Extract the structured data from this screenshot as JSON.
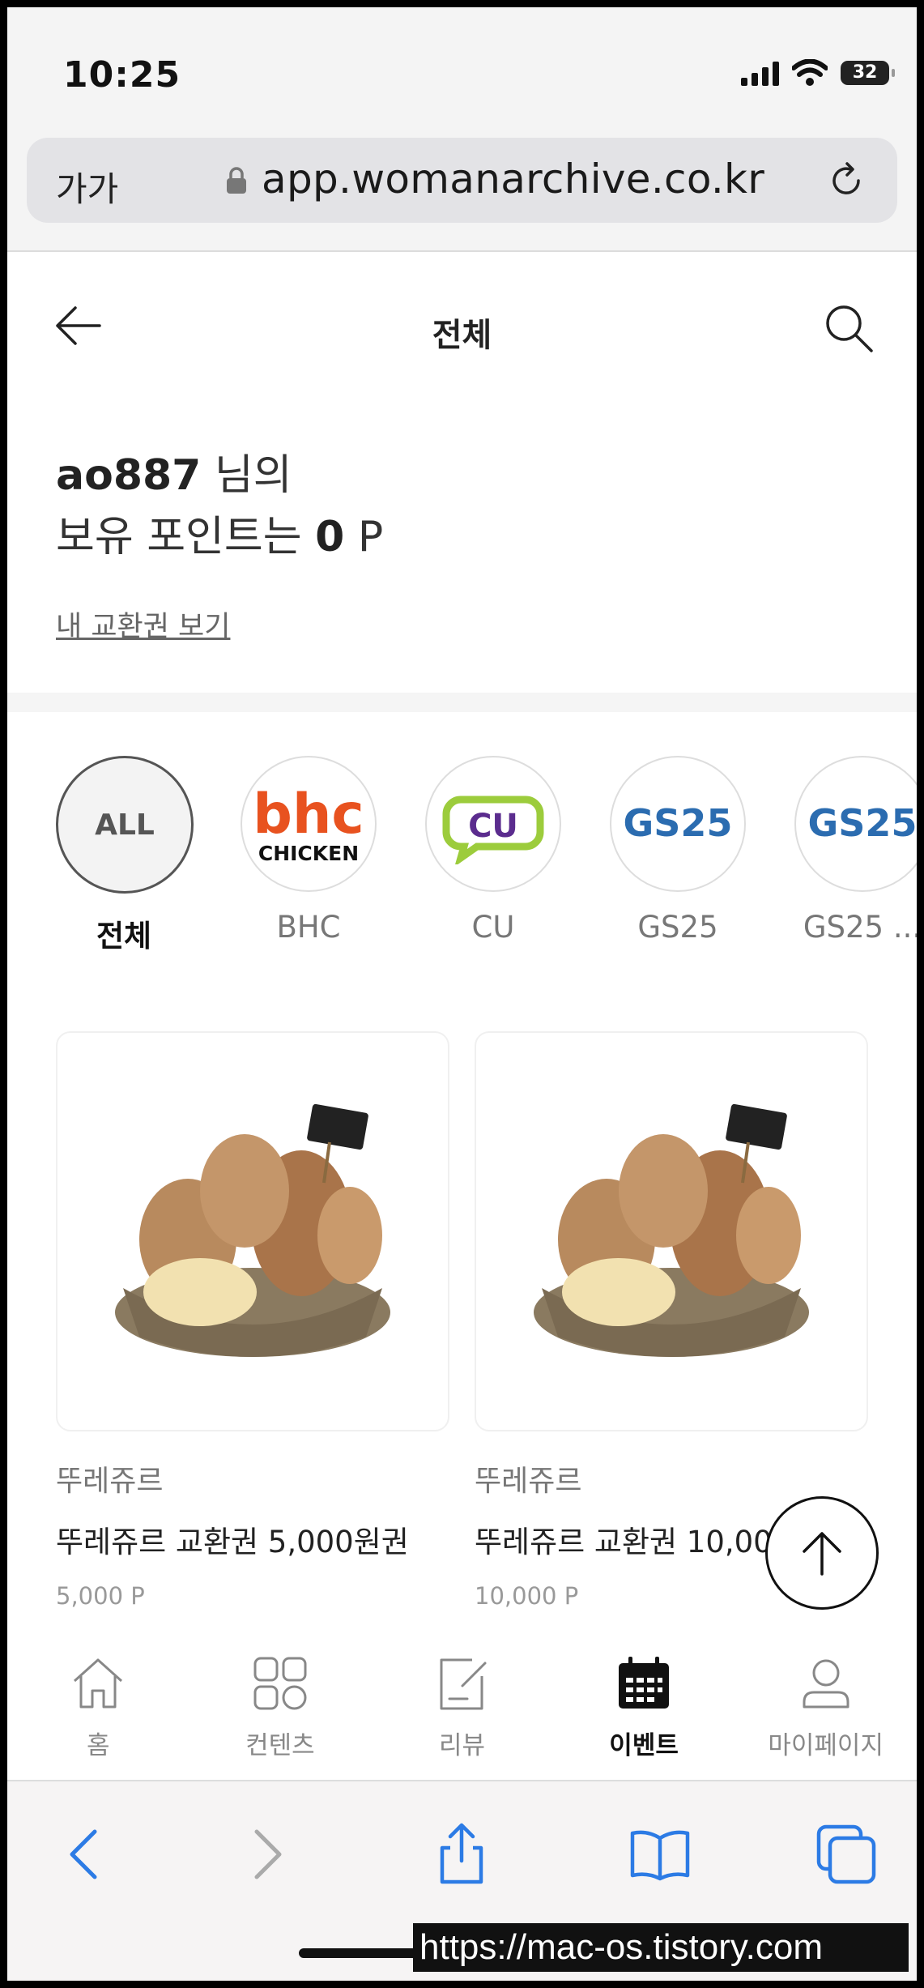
{
  "status_bar": {
    "time": "10:25",
    "battery": "32"
  },
  "browser": {
    "text_size": "가가",
    "url": "app.womanarchive.co.kr"
  },
  "header": {
    "title": "전체"
  },
  "points": {
    "username": "ao887",
    "suffix": "님의",
    "line2_prefix": "보유 포인트는",
    "amount": "0",
    "unit": "P",
    "voucher_link": "내 교환권 보기"
  },
  "brands": [
    {
      "label": "전체",
      "logo_text": "ALL"
    },
    {
      "label": "BHC",
      "logo_text_top": "bhc",
      "logo_text_bottom": "CHICKEN"
    },
    {
      "label": "CU",
      "logo_text": "CU"
    },
    {
      "label": "GS25",
      "logo_text": "GS25"
    },
    {
      "label": "GS25 ...",
      "logo_text": "GS25"
    }
  ],
  "products": [
    {
      "brand": "뚜레쥬르",
      "name": "뚜레쥬르 교환권 5,000원권",
      "price": "5,000 P"
    },
    {
      "brand": "뚜레쥬르",
      "name": "뚜레쥬르 교환권 10,00",
      "price": "10,000 P"
    }
  ],
  "tabs": [
    {
      "label": "홈",
      "icon": "home-icon"
    },
    {
      "label": "컨텐츠",
      "icon": "grid-icon"
    },
    {
      "label": "리뷰",
      "icon": "review-icon"
    },
    {
      "label": "이벤트",
      "icon": "calendar-icon"
    },
    {
      "label": "마이페이지",
      "icon": "person-icon"
    }
  ],
  "watermark": "https://mac-os.tistory.com",
  "colors": {
    "link_blue": "#2c7be5",
    "bhc_orange": "#e8521f",
    "cu_purple": "#5b2c8e",
    "cu_green": "#9ccc3c",
    "gs_blue": "#2b6cb0",
    "gs_cyan": "#4fc3e8"
  }
}
